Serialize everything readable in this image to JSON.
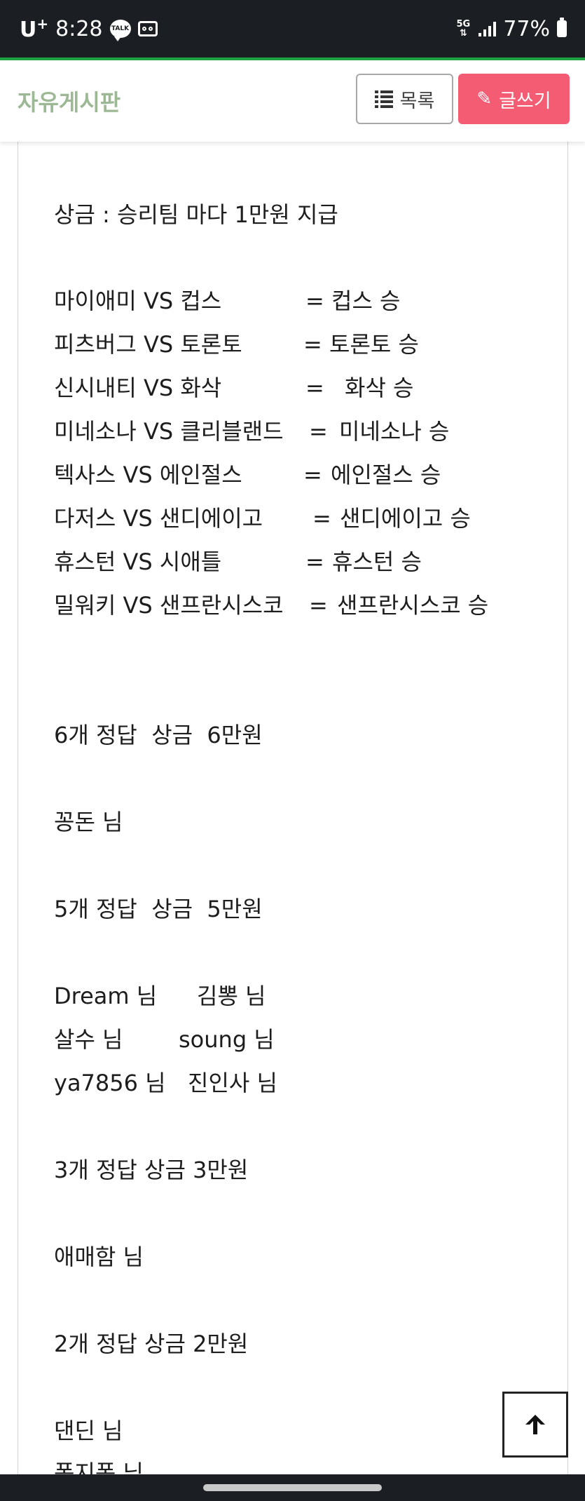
{
  "status_bar": {
    "carrier": "U",
    "carrier_sup": "+",
    "time": "8:28",
    "talk_label": "TALK",
    "network": "5G",
    "battery": "77%",
    "icons": [
      "kakaotalk-icon",
      "voicemail-icon",
      "5g-icon",
      "signal-icon",
      "battery-icon"
    ]
  },
  "header": {
    "title": "자유게시판",
    "list_button": "목록",
    "write_button": "글쓰기",
    "colors": {
      "title": "#9cb894",
      "write_bg": "#f35c72",
      "accent_line": "#1fa443"
    }
  },
  "post": {
    "prize_line": "상금 : 승리팀 마다 1만원 지급",
    "matches": [
      {
        "a": "마이애미",
        "vs": "VS",
        "b": "컵스",
        "eq": "=",
        "result": "컵스 승"
      },
      {
        "a": "피츠버그",
        "vs": "VS",
        "b": "토론토",
        "eq": "=",
        "result": "토론토 승"
      },
      {
        "a": "신시내티",
        "vs": "VS",
        "b": "화삭",
        "eq": "=",
        "result": "화삭 승"
      },
      {
        "a": "미네소나",
        "vs": "VS",
        "b": "클리블랜드",
        "eq": "=",
        "result": "미네소나 승"
      },
      {
        "a": "텍사스",
        "vs": "VS",
        "b": "에인절스",
        "eq": "=",
        "result": "에인절스 승"
      },
      {
        "a": "다저스",
        "vs": "VS",
        "b": "샌디에이고",
        "eq": "=",
        "result": "샌디에이고 승"
      },
      {
        "a": "휴스턴",
        "vs": "VS",
        "b": "시애틀",
        "eq": "=",
        "result": "휴스턴 승"
      },
      {
        "a": "밀워키",
        "vs": "VS",
        "b": "샌프란시스코",
        "eq": "=",
        "result": "샌프란시스코 승"
      }
    ],
    "tier6": {
      "heading": "6개 정답  상금  6만원",
      "winners": "꽁돈 님"
    },
    "tier5": {
      "heading": "5개 정답  상금  5만원",
      "rows": [
        {
          "left": "Dream 님",
          "right": "김뽕 님"
        },
        {
          "left": "살수 님",
          "right": "soung 님"
        },
        {
          "left": "ya7856 님",
          "right": "진인사 님"
        }
      ]
    },
    "tier3": {
      "heading": "3개 정답 상금 3만원",
      "winners": "애매함 님"
    },
    "tier2": {
      "heading": "2개 정답 상금 2만원",
      "winners": [
        "댄딘 님",
        "퐁지퐁 님"
      ]
    }
  },
  "scroll_top": {
    "icon": "arrow-up-icon"
  }
}
